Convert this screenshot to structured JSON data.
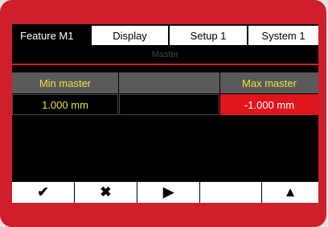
{
  "tabs": [
    {
      "label": "Feature  M1",
      "active": true
    },
    {
      "label": "Display",
      "active": false
    },
    {
      "label": "Setup 1",
      "active": false
    },
    {
      "label": "System 1",
      "active": false
    }
  ],
  "title": "Master",
  "table": {
    "headers": [
      "Min master",
      "",
      "Max master"
    ],
    "values": [
      "1.000 mm",
      "",
      "-1.000 mm"
    ]
  },
  "softkeys": [
    {
      "icon": "checkmark-icon",
      "glyph": "✔"
    },
    {
      "icon": "cross-icon",
      "glyph": "✖"
    },
    {
      "icon": "play-icon",
      "glyph": "▶"
    },
    {
      "icon": "blank",
      "glyph": ""
    },
    {
      "icon": "up-arrow-icon",
      "glyph": "▲"
    }
  ],
  "colors": {
    "frame": "#cf1f2a",
    "accent_text": "#e8e23b",
    "header_bg": "#5a5a5a",
    "alert_bg": "#e1151c"
  }
}
